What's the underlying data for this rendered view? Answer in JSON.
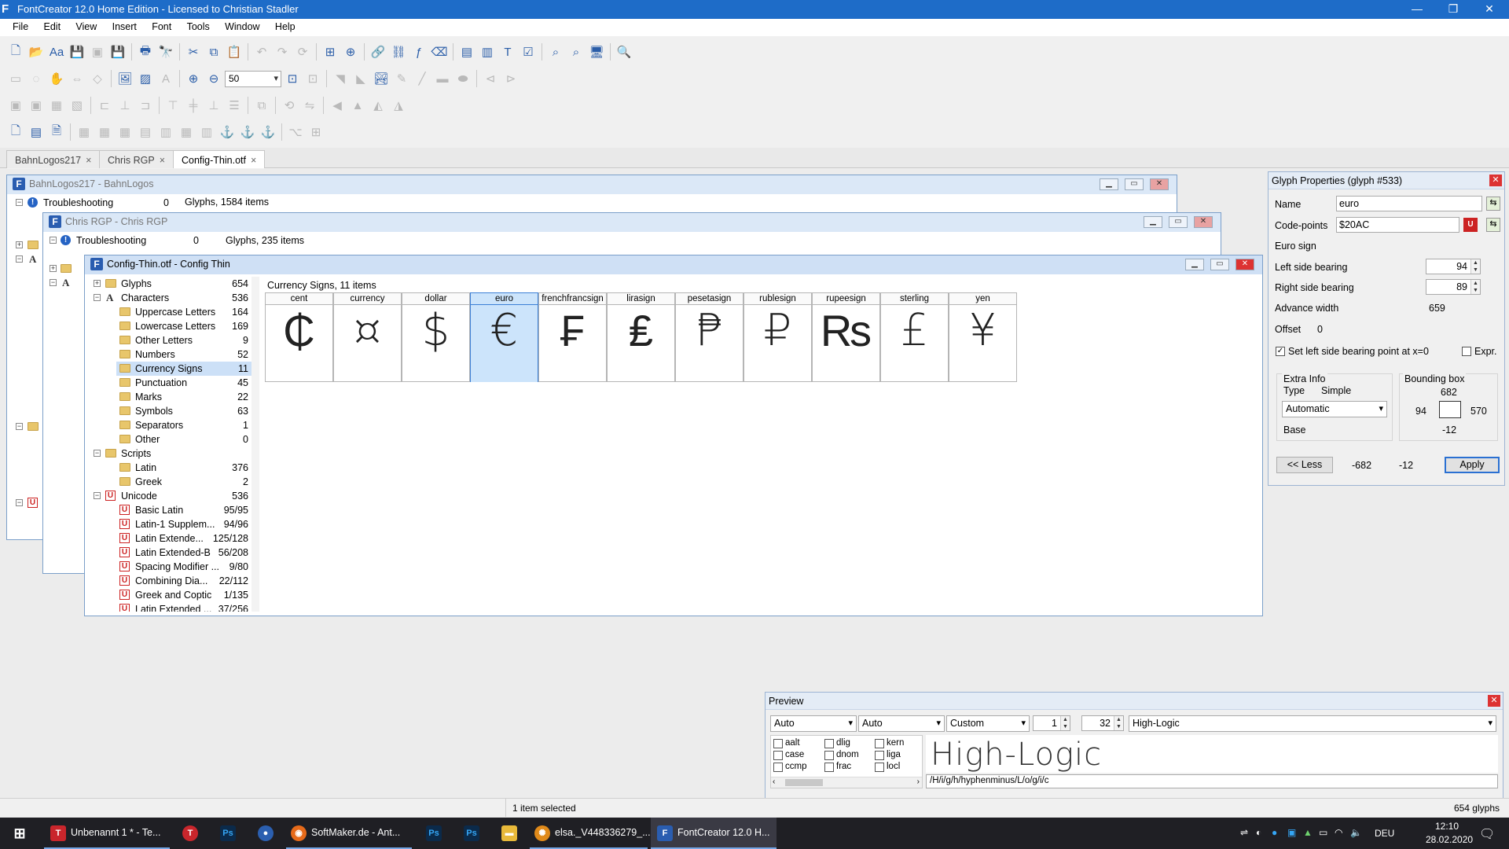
{
  "app": {
    "title": "FontCreator 12.0 Home Edition - Licensed to Christian Stadler",
    "window_controls": {
      "minimize": "—",
      "restore": "❐",
      "close": "✕"
    }
  },
  "menu": [
    "File",
    "Edit",
    "View",
    "Insert",
    "Font",
    "Tools",
    "Window",
    "Help"
  ],
  "toolbar": {
    "zoom_value": "50"
  },
  "doc_tabs": [
    {
      "label": "BahnLogos217",
      "close": "×"
    },
    {
      "label": "Chris RGP",
      "close": "×"
    },
    {
      "label": "Config-Thin.otf",
      "close": "×"
    }
  ],
  "win_bahn": {
    "title": "BahnLogos217 - BahnLogos",
    "tree_item": "Troubleshooting",
    "tree_count": "0",
    "header": "Glyphs, 1584 items",
    "side_letter": "A"
  },
  "win_chris": {
    "title": "Chris RGP - Chris RGP",
    "tree_item": "Troubleshooting",
    "tree_count": "0",
    "header": "Glyphs, 235 items",
    "side_letter": "A"
  },
  "win_config": {
    "title": "Config-Thin.otf - Config Thin",
    "header": "Currency Signs, 11 items",
    "tree": [
      {
        "label": "Glyphs",
        "count": "654"
      },
      {
        "label": "Characters",
        "count": "536"
      },
      {
        "label": "Uppercase Letters",
        "count": "164"
      },
      {
        "label": "Lowercase Letters",
        "count": "169"
      },
      {
        "label": "Other Letters",
        "count": "9"
      },
      {
        "label": "Numbers",
        "count": "52"
      },
      {
        "label": "Currency Signs",
        "count": "11"
      },
      {
        "label": "Punctuation",
        "count": "45"
      },
      {
        "label": "Marks",
        "count": "22"
      },
      {
        "label": "Symbols",
        "count": "63"
      },
      {
        "label": "Separators",
        "count": "1"
      },
      {
        "label": "Other",
        "count": "0"
      },
      {
        "label": "Scripts",
        "count": ""
      },
      {
        "label": "Latin",
        "count": "376"
      },
      {
        "label": "Greek",
        "count": "2"
      },
      {
        "label": "Unicode",
        "count": "536"
      },
      {
        "label": "Basic Latin",
        "count": "95/95"
      },
      {
        "label": "Latin-1 Supplem...",
        "count": "94/96"
      },
      {
        "label": "Latin Extende...",
        "count": "125/128"
      },
      {
        "label": "Latin Extended-B",
        "count": "56/208"
      },
      {
        "label": "Spacing Modifier ...",
        "count": "9/80"
      },
      {
        "label": "Combining Dia...",
        "count": "22/112"
      },
      {
        "label": "Greek and Coptic",
        "count": "1/135"
      },
      {
        "label": "Latin Extended ...",
        "count": "37/256"
      }
    ],
    "glyphs": [
      {
        "name": "cent",
        "glyph": "₵"
      },
      {
        "name": "currency",
        "glyph": "¤"
      },
      {
        "name": "dollar",
        "glyph": "$"
      },
      {
        "name": "euro",
        "glyph": "€"
      },
      {
        "name": "frenchfrancsign",
        "glyph": "₣"
      },
      {
        "name": "lirasign",
        "glyph": "₤"
      },
      {
        "name": "pesetasign",
        "glyph": "₱"
      },
      {
        "name": "rublesign",
        "glyph": "₽"
      },
      {
        "name": "rupeesign",
        "glyph": "₨"
      },
      {
        "name": "sterling",
        "glyph": "£"
      },
      {
        "name": "yen",
        "glyph": "¥"
      }
    ]
  },
  "glyph_props": {
    "title": "Glyph Properties (glyph #533)",
    "name_label": "Name",
    "name_value": "euro",
    "codepoints_label": "Code-points",
    "codepoints_value": "$20AC",
    "description": "Euro sign",
    "lsb_label": "Left side bearing",
    "lsb_value": "94",
    "rsb_label": "Right side bearing",
    "rsb_value": "89",
    "advance_label": "Advance width",
    "advance_value": "659",
    "offset_label": "Offset",
    "offset_value": "0",
    "set_lsb_label": "Set left side bearing point at x=0",
    "expr_label": "Expr.",
    "extra_info_label": "Extra Info",
    "type_label": "Type",
    "type_value": "Simple",
    "auto_value": "Automatic",
    "base_label": "Base",
    "bbox_label": "Bounding box",
    "bbox_top": "682",
    "bbox_left": "94",
    "bbox_right": "570",
    "bbox_bottom": "-12",
    "less_button": "<< Less",
    "bottom_a": "-682",
    "bottom_b": "-12",
    "apply_button": "Apply"
  },
  "preview": {
    "title": "Preview",
    "select1": "Auto",
    "select2": "Auto",
    "select3": "Custom",
    "spin1": "1",
    "spin2": "32",
    "font_select": "High-Logic",
    "features": [
      "aalt",
      "dlig",
      "kern",
      "case",
      "dnom",
      "liga",
      "ccmp",
      "frac",
      "locl"
    ],
    "sample_text": "High-Logic",
    "glyph_string": "/H/i/g/h/hyphenminus/L/o/g/i/c"
  },
  "status": {
    "selected": "1 item selected",
    "glyphs": "654 glyphs"
  },
  "taskbar": {
    "items": [
      {
        "label": "Unbenannt 1 * - Te..."
      },
      {
        "label": ""
      },
      {
        "label": ""
      },
      {
        "label": ""
      },
      {
        "label": "SoftMaker.de - Ant..."
      },
      {
        "label": ""
      },
      {
        "label": ""
      },
      {
        "label": ""
      },
      {
        "label": "elsa._V448336279_..."
      },
      {
        "label": "FontCreator 12.0 H..."
      }
    ],
    "lang": "DEU",
    "time": "12:10",
    "date": "28.02.2020"
  }
}
